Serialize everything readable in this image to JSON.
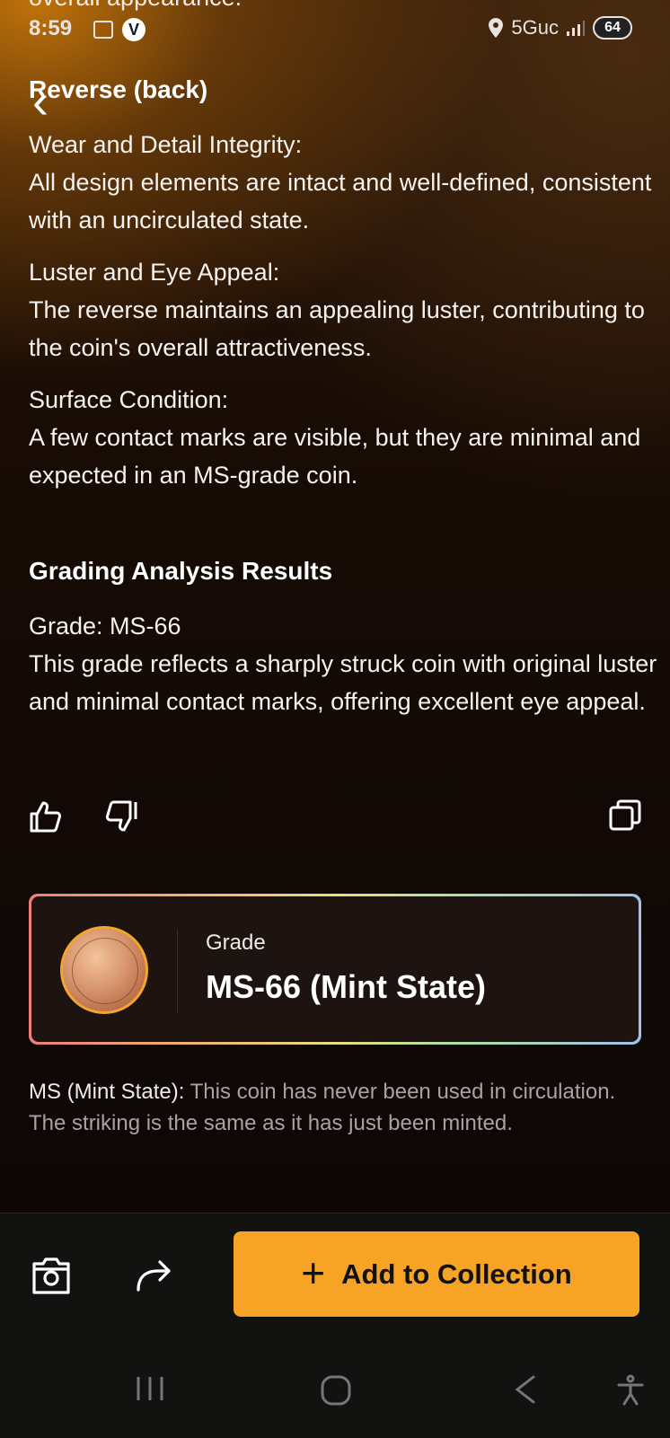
{
  "top_cut_text": "overall appearance.",
  "status": {
    "time": "8:59",
    "network": "5Guc",
    "battery": "64"
  },
  "reverse": {
    "title": "Reverse (back)",
    "items": [
      {
        "label": "Wear and Detail Integrity:",
        "text": "All design elements are intact and well-defined, consistent with an uncirculated state."
      },
      {
        "label": "Luster and Eye Appeal:",
        "text": "The reverse maintains an appealing luster, contributing to the coin's overall attractiveness."
      },
      {
        "label": "Surface Condition:",
        "text": "A few contact marks are visible, but they are minimal and expected in an MS-grade coin."
      }
    ]
  },
  "results": {
    "title": "Grading Analysis Results",
    "grade_line": "Grade: MS-66",
    "description": "This grade reflects a sharply struck coin with original luster and minimal contact marks, offering excellent eye appeal."
  },
  "grade_card": {
    "label": "Grade",
    "value": "MS-66 (Mint State)"
  },
  "ms_note": {
    "lead": "MS (Mint State):",
    "text": " This coin has never been used in circulation. The striking is the same as it has just been minted."
  },
  "actions": {
    "add_label": "Add to Collection"
  },
  "icons": [
    "back-arrow-icon",
    "thumbs-up-icon",
    "thumbs-down-icon",
    "copy-icon",
    "camera-icon",
    "share-icon",
    "plus-icon",
    "recent-apps-icon",
    "home-icon",
    "back-nav-icon",
    "accessibility-icon",
    "location-icon",
    "signal-icon"
  ]
}
